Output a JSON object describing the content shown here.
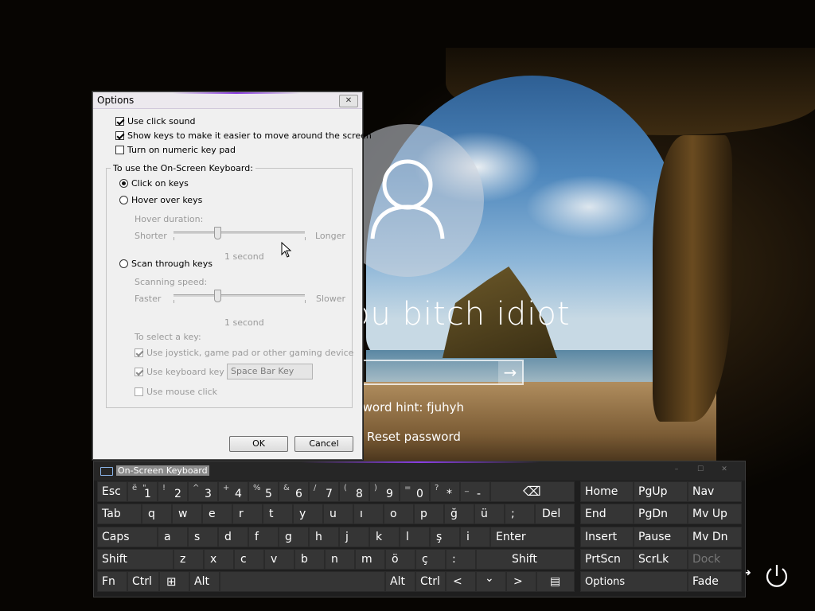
{
  "lock": {
    "username": "ou bitch idiot",
    "password_hint": "Password hint: fjuhyh",
    "password_hint_visible": "ssword hint: fjuhyh",
    "reset_password": "Reset password",
    "submit_arrow": "→",
    "ease_arrow": "➜"
  },
  "options": {
    "title": "Options",
    "close": "✕",
    "use_click_sound": "Use click sound",
    "show_keys": "Show keys to make it easier to move around the screen",
    "numeric_pad": "Turn on numeric key pad",
    "group_label": "To use the On-Screen Keyboard:",
    "click_on_keys": "Click on keys",
    "hover_over_keys": "Hover over keys",
    "hover_duration": "Hover duration:",
    "shorter": "Shorter",
    "longer": "Longer",
    "hover_value": "1 second",
    "scan_through_keys": "Scan through keys",
    "scanning_speed": "Scanning speed:",
    "faster": "Faster",
    "slower": "Slower",
    "scan_value": "1 second",
    "to_select": "To select a key:",
    "use_joystick": "Use joystick, game pad or other gaming device",
    "use_keyboard_key": "Use keyboard key",
    "keyboard_key_value": "Space Bar Key",
    "use_mouse_click": "Use mouse click",
    "ok": "OK",
    "cancel": "Cancel",
    "checks": {
      "click_sound": true,
      "show_keys": true,
      "numeric_pad": false,
      "joystick": true,
      "keyboard_key": true,
      "mouse_click": false
    },
    "slider_hover_fraction": 0.34,
    "slider_scan_fraction": 0.34
  },
  "osk": {
    "title": "On-Screen Keyboard",
    "min": "–",
    "max": "☐",
    "close": "✕",
    "row1": [
      {
        "main": "Esc",
        "sub": "",
        "sub2": "",
        "w": 56
      },
      {
        "main": "1",
        "sub": "ë",
        "sub2": "\"",
        "w": 36
      },
      {
        "main": "2",
        "sub": "!",
        "sub2": "",
        "w": 36
      },
      {
        "main": "3",
        "sub": "^",
        "sub2": "",
        "w": 36
      },
      {
        "main": "4",
        "sub": "+",
        "sub2": "",
        "w": 36
      },
      {
        "main": "5",
        "sub": "$",
        "sub2": "%",
        "w": 36
      },
      {
        "main": "6",
        "sub": "&",
        "sub2": "",
        "w": 36
      },
      {
        "main": "7",
        "sub": "/",
        "sub2": "",
        "w": 36
      },
      {
        "main": "8",
        "sub": "(",
        "sub2": "",
        "w": 36
      },
      {
        "main": "9",
        "sub": ")",
        "sub2": "",
        "w": 36
      },
      {
        "main": "0",
        "sub": "=",
        "sub2": "",
        "w": 36
      },
      {
        "main": "*",
        "sub": "?",
        "sub2": "",
        "w": 36
      },
      {
        "main": "-",
        "sub": "_",
        "sub2": "",
        "w": 36
      },
      {
        "main": "⌫",
        "sub": "",
        "sub2": "",
        "w": 68
      }
    ],
    "row2": [
      "Tab",
      "q",
      "w",
      "e",
      "r",
      "t",
      "y",
      "u",
      "ı",
      "o",
      "p",
      "ğ",
      "ü",
      ";",
      "Del"
    ],
    "row3": [
      "Caps",
      "a",
      "s",
      "d",
      "f",
      "g",
      "h",
      "j",
      "k",
      "l",
      "ş",
      "i",
      "Enter"
    ],
    "row4": [
      "Shift",
      "z",
      "x",
      "c",
      "v",
      "b",
      "n",
      "m",
      "ö",
      "ç",
      ":",
      "Shift"
    ],
    "row5": [
      "Fn",
      "Ctrl",
      "⊞",
      "Alt",
      "",
      "Alt",
      "Ctrl",
      "<",
      "⌄",
      ">",
      "▤"
    ],
    "nav": {
      "home": "Home",
      "pgup": "PgUp",
      "nav": "Nav",
      "end": "End",
      "pgdn": "PgDn",
      "mvup": "Mv Up",
      "insert": "Insert",
      "pause": "Pause",
      "mvdn": "Mv Dn",
      "prtscn": "PrtScn",
      "scrlk": "ScrLk",
      "dock": "Dock",
      "options": "Options",
      "fade": "Fade"
    }
  }
}
